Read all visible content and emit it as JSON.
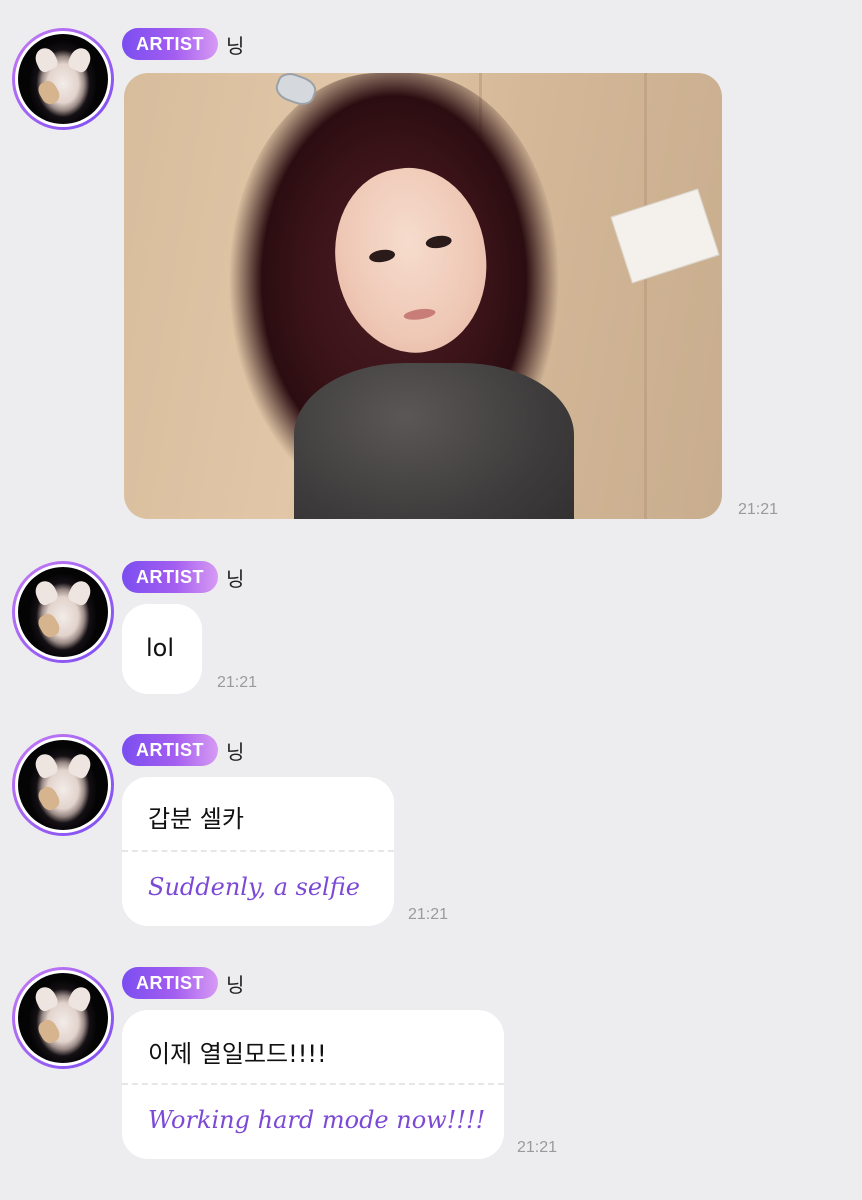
{
  "messages": [
    {
      "badge": "ARTIST",
      "name": "닝",
      "type": "photo",
      "photo_alt": "selfie photo",
      "time": "21:21"
    },
    {
      "badge": "ARTIST",
      "name": "닝",
      "type": "text",
      "text": "lol",
      "time": "21:21"
    },
    {
      "badge": "ARTIST",
      "name": "닝",
      "type": "translated",
      "text": "갑분 셀카",
      "translation": "Suddenly, a selfie",
      "time": "21:21"
    },
    {
      "badge": "ARTIST",
      "name": "닝",
      "type": "translated",
      "text": "이제 열일모드!!!!",
      "translation": "Working hard mode now!!!!",
      "time": "21:21"
    }
  ],
  "colors": {
    "background": "#ededef",
    "badge_start": "#7b4ef0",
    "badge_end": "#d79af3",
    "translation": "#7c49d6",
    "timestamp": "#9a9a9a"
  },
  "icons": {
    "avatar": "cat-avatar"
  }
}
